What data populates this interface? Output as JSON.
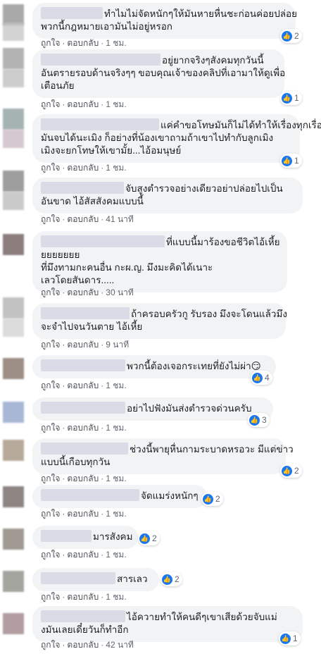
{
  "actions": {
    "like": "ถูกใจ",
    "reply": "ตอบกลับ"
  },
  "comments": [
    {
      "lines": [
        "ทำไมไม่จัดหนักๆให้มันหายหื่นชะก่อนค่อยปล่อย",
        "พวกนี้กฎหมายเอามันไม่อยู่หรอก"
      ],
      "time": "1 ชม.",
      "likes": "2"
    },
    {
      "lines": [
        "อยู่ยากจริงๆสังคมทุกวันนี้",
        "อันตรายรอบด้านจริงๆๆ ขอบคุณเจ้าของคลิปที่เอามาให้ดูเพื่อ",
        "เตือนภัย"
      ],
      "time": "1 ชม.",
      "likes": "1"
    },
    {
      "lines": [
        "แค่คำขอโทษมันก็ไม่ได้ทำให้เรื่องทุกเรื่อง",
        "มันจบได้นะเมิง ก็อย่างที่น้องเขาถามถ้าเขาไปทำกับลูกเมิง",
        "เมิงจะยกโทษให้เขามั้ย...ไอ้อมนุษย์"
      ],
      "time": "1 ชม.",
      "likes": "1"
    },
    {
      "lines": [
        "จับสูงตำรวจอย่างเดียวอย่าปล่อยไปเป็น",
        "อันขาด ไอ้สัสสังคมแบบนี้"
      ],
      "time": "41 นาที",
      "likes": ""
    },
    {
      "lines": [
        "ที่แบบนี้มาร้องขอชีวิตไอ้เหี้ย",
        "ยยยยยยย",
        "ที่มึงทามกะคนอื่น กะผ.ญ. มึงมะคิดได้เนาะ",
        "เลวโดยสันดาร....."
      ],
      "time": "30 นาที",
      "likes": ""
    },
    {
      "lines": [
        "ถ้าครอบครัวกู รับรอง มึงจะโดนแล้วมึง",
        "จะจำไปจนวันตาย ไอ้เหี้ย"
      ],
      "time": "9 นาที",
      "likes": ""
    },
    {
      "lines": [
        "พวกนี้ต้องเจอกระเทยที่ยังไม่ผ่า😏"
      ],
      "time": "1 ชม.",
      "likes": "4"
    },
    {
      "lines": [
        "อย่าไปฟังมันส่งตำรวจด่วนครับ"
      ],
      "time": "1 ชม.",
      "likes": "3"
    },
    {
      "lines": [
        "ช่วงนี้พายุหื่นกามระบาดหรอวะ มีแต่ข่าว",
        "แบบนี้เกือบทุกวัน"
      ],
      "time": "1 ชม.",
      "likes": "2"
    },
    {
      "lines": [
        "จัดแมร่งหนักๆ"
      ],
      "time": "1 ชม.",
      "likes": "2"
    },
    {
      "lines": [
        "มารสังคม"
      ],
      "time": "1 ชม.",
      "likes": "2"
    },
    {
      "lines": [
        "สารเลว"
      ],
      "time": "1 ชม.",
      "likes": "2"
    },
    {
      "lines": [
        "ไอ้ควายทำให้คนดีๆเขาเสียด้วยจับแม่",
        "งมันเลยเดี๋ยวันก็ทำอีก"
      ],
      "time": "42 นาที",
      "likes": "1"
    }
  ],
  "icons": {
    "like": "thumbs-up-icon"
  },
  "colors": {
    "bubble": "#f2f3f5",
    "like_badge": "#1877f2",
    "meta": "#606770"
  }
}
